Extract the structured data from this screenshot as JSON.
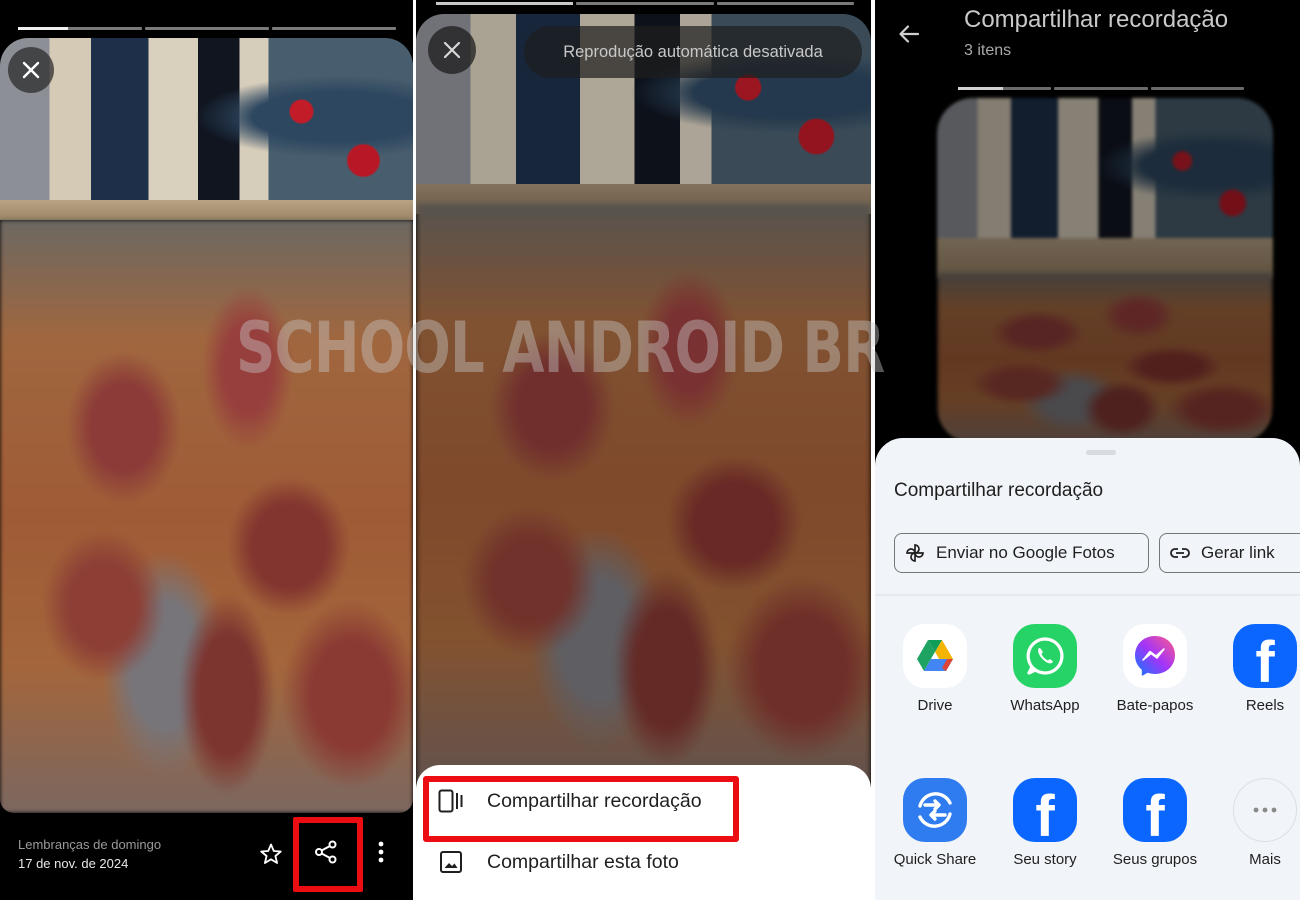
{
  "watermark": "SCHOOL ANDROID BR",
  "panel1": {
    "progress": [
      0.4,
      0,
      0
    ],
    "close_icon": "close-icon",
    "album_title": "Lembranças de domingo",
    "date": "17 de nov. de 2024",
    "actions": [
      "star-icon",
      "share-icon",
      "more-vert-icon"
    ],
    "highlight": "share-button",
    "highlight_color": "#ec0d12"
  },
  "panel2": {
    "progress": [
      1,
      0,
      0
    ],
    "toast": "Reprodução automática desativada",
    "menu": [
      {
        "icon": "memory-share-icon",
        "label": "Compartilhar recordação"
      },
      {
        "icon": "image-icon",
        "label": "Compartilhar esta foto"
      }
    ],
    "highlight": "Compartilhar recordação",
    "highlight_color": "#ec0d12"
  },
  "panel3": {
    "title": "Compartilhar recordação",
    "subtitle": "3 itens",
    "progress": [
      0.48,
      0,
      0
    ],
    "sheet": {
      "title": "Compartilhar recordação",
      "chips": [
        {
          "icon": "pinwheel-icon",
          "label": "Enviar no Google Fotos"
        },
        {
          "icon": "link-icon",
          "label": "Gerar link"
        }
      ],
      "apps_row1": [
        {
          "icon": "google-drive-icon",
          "label": "Drive"
        },
        {
          "icon": "whatsapp-icon",
          "label": "WhatsApp"
        },
        {
          "icon": "messenger-icon",
          "label": "Bate-papos"
        },
        {
          "icon": "facebook-icon",
          "label": "Reels"
        }
      ],
      "apps_row2": [
        {
          "icon": "quick-share-icon",
          "label": "Quick Share"
        },
        {
          "icon": "facebook-icon",
          "label": "Seu story"
        },
        {
          "icon": "facebook-icon",
          "label": "Seus grupos"
        },
        {
          "icon": "more-horiz-icon",
          "label": "Mais"
        }
      ]
    },
    "colors": {
      "facebook": "#0a66ff",
      "whatsapp": "#25d366",
      "sheet_bg": "#f1f4f8"
    }
  }
}
